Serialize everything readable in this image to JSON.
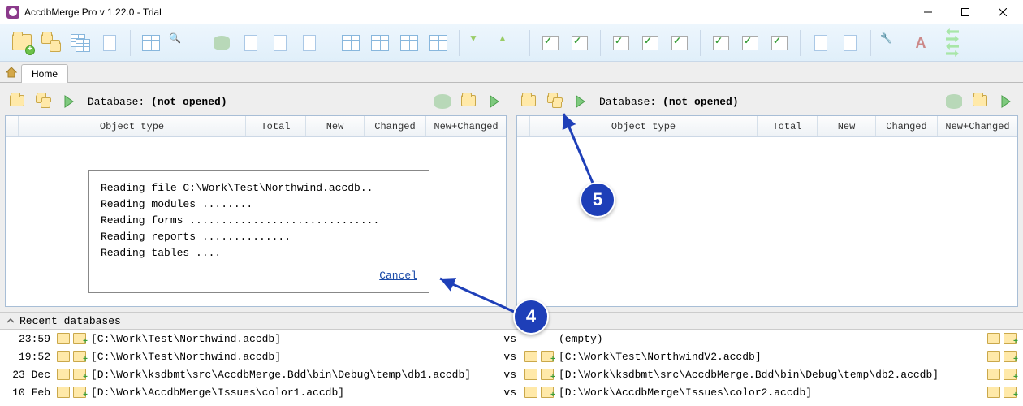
{
  "window": {
    "title": "AccdbMerge Pro v 1.22.0 - Trial"
  },
  "tab": {
    "home": "Home"
  },
  "panel": {
    "db_label_prefix": "Database: ",
    "db_value": "(not opened)",
    "columns": {
      "object_type": "Object type",
      "total": "Total",
      "new": "New",
      "changed": "Changed",
      "new_changed": "New+Changed"
    }
  },
  "progress": {
    "lines": [
      "Reading file C:\\Work\\Test\\Northwind.accdb..",
      "Reading modules ........",
      "Reading forms ..............................",
      "Reading reports ..............",
      "Reading tables ...."
    ],
    "cancel": "Cancel"
  },
  "recent": {
    "header": "Recent databases",
    "empty": "(empty)",
    "vs": "vs",
    "rows": [
      {
        "time": "23:59",
        "left": "[C:\\Work\\Test\\Northwind.accdb]",
        "right": ""
      },
      {
        "time": "19:52",
        "left": "[C:\\Work\\Test\\Northwind.accdb]",
        "right": "[C:\\Work\\Test\\NorthwindV2.accdb]"
      },
      {
        "time": "23 Dec",
        "left": "[D:\\Work\\ksdbmt\\src\\AccdbMerge.Bdd\\bin\\Debug\\temp\\db1.accdb]",
        "right": "[D:\\Work\\ksdbmt\\src\\AccdbMerge.Bdd\\bin\\Debug\\temp\\db2.accdb]"
      },
      {
        "time": "10 Feb",
        "left": "[D:\\Work\\AccdbMerge\\Issues\\color1.accdb]",
        "right": "[D:\\Work\\AccdbMerge\\Issues\\color2.accdb]"
      }
    ]
  },
  "annotations": {
    "b4": "4",
    "b5": "5"
  }
}
